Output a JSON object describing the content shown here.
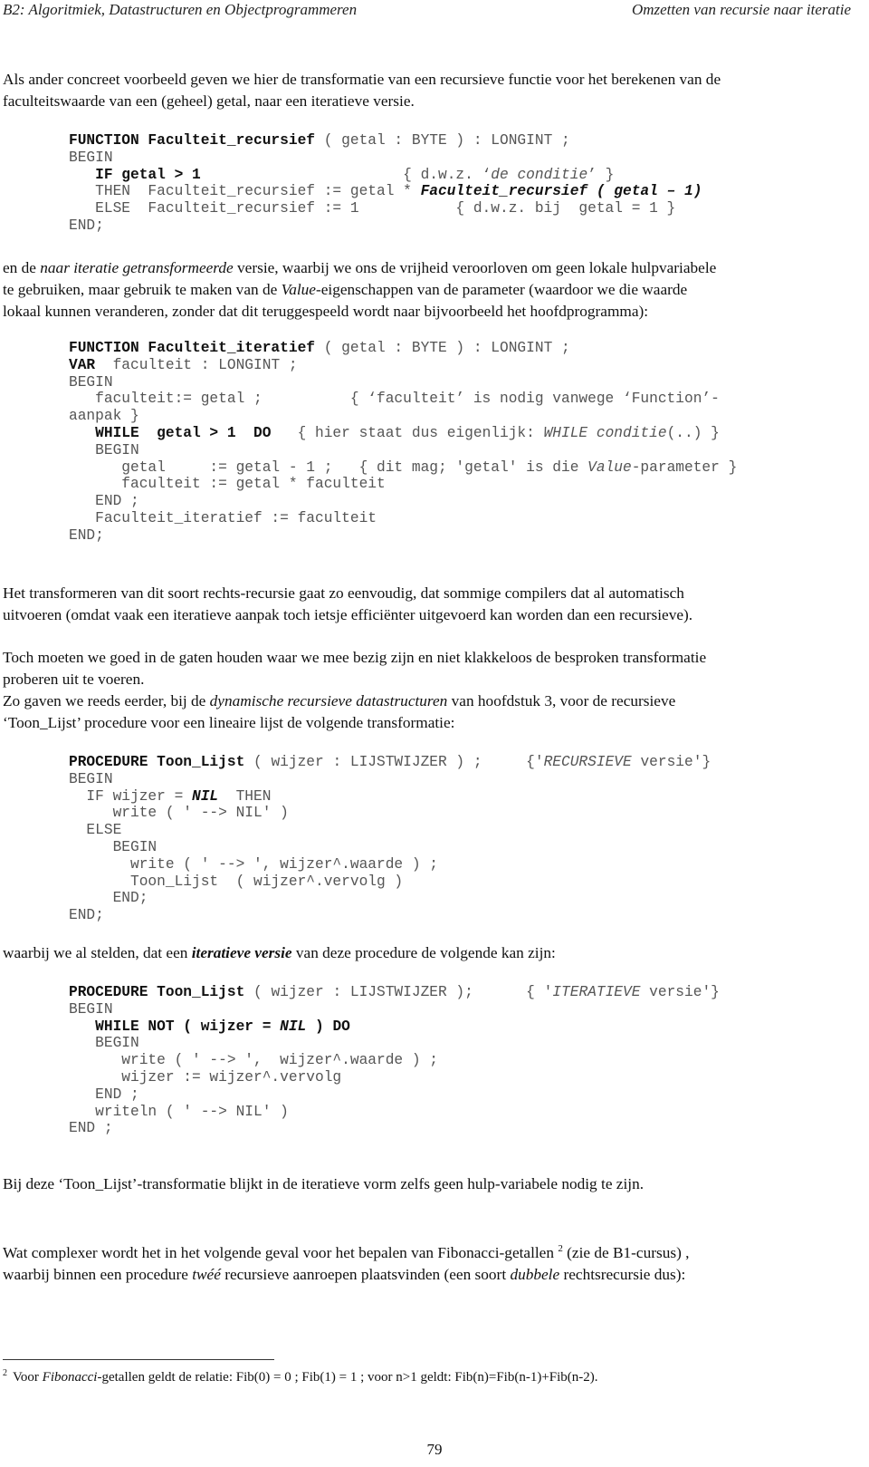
{
  "header": {
    "left": "B2: Algoritmiek, Datastructuren en Objectprogrammeren",
    "right": "Omzetten van recursie naar iteratie"
  },
  "intro": {
    "line1": "Als ander concreet voorbeeld geven we hier de transformatie van een recursieve functie voor het berekenen van de",
    "line2": "faculteitswaarde van een (geheel) getal, naar een iteratieve versie."
  },
  "code1": [
    {
      "parts": [
        {
          "t": "FUNCTION Faculteit_recursief",
          "s": "b"
        },
        {
          "t": " ( getal : BYTE ) : LONGINT ;",
          "s": ""
        }
      ]
    },
    {
      "parts": [
        {
          "t": "BEGIN",
          "s": ""
        }
      ]
    },
    {
      "parts": [
        {
          "t": "   IF getal > 1",
          "s": "b"
        },
        {
          "t": "                       { d.w.z. ‘",
          "s": ""
        },
        {
          "t": "de conditie",
          "s": "i"
        },
        {
          "t": "’ }",
          "s": ""
        }
      ]
    },
    {
      "parts": [
        {
          "t": "   THEN  Faculteit_recursief := getal * ",
          "s": ""
        },
        {
          "t": "Faculteit_recursief ( getal – 1)",
          "s": "bi"
        }
      ]
    },
    {
      "parts": [
        {
          "t": "   ELSE  Faculteit_recursief := 1           { d.w.z. bij  getal = 1 }",
          "s": ""
        }
      ]
    },
    {
      "parts": [
        {
          "t": "END;",
          "s": ""
        }
      ]
    }
  ],
  "para2": {
    "a": "en de ",
    "a_it": "naar iteratie getransformeerde",
    "b": " versie, waarbij we ons de vrijheid veroorloven om geen lokale hulpvariabele",
    "c": "te gebruiken, maar gebruik te maken van de ",
    "c_it": "Value",
    "d": "-eigenschappen van de parameter (waardoor we die waarde",
    "e": "lokaal kunnen veranderen, zonder dat dit teruggespeeld wordt naar bijvoorbeeld het hoofdprogramma):"
  },
  "code2": [
    {
      "parts": [
        {
          "t": "FUNCTION Faculteit_iteratief",
          "s": "b"
        },
        {
          "t": " ( getal : BYTE ) : LONGINT ;",
          "s": ""
        }
      ]
    },
    {
      "parts": [
        {
          "t": "VAR",
          "s": "b"
        },
        {
          "t": "  faculteit : LONGINT ;",
          "s": ""
        }
      ]
    },
    {
      "parts": [
        {
          "t": "BEGIN",
          "s": ""
        }
      ]
    },
    {
      "parts": [
        {
          "t": "   faculteit:= getal ;          { ‘faculteit’ is nodig vanwege ‘Function’-",
          "s": ""
        }
      ]
    },
    {
      "parts": [
        {
          "t": "aanpak }",
          "s": ""
        }
      ]
    },
    {
      "parts": [
        {
          "t": "   WHILE  getal > 1  DO",
          "s": "b"
        },
        {
          "t": "   { hier staat dus eigenlijk: ",
          "s": ""
        },
        {
          "t": "WHILE conditie",
          "s": "i"
        },
        {
          "t": "(..) }",
          "s": ""
        }
      ]
    },
    {
      "parts": [
        {
          "t": "   BEGIN",
          "s": ""
        }
      ]
    },
    {
      "parts": [
        {
          "t": "      getal     := getal - 1 ;   { dit mag; 'getal' is die ",
          "s": ""
        },
        {
          "t": "Value",
          "s": "i"
        },
        {
          "t": "-parameter }",
          "s": ""
        }
      ]
    },
    {
      "parts": [
        {
          "t": "      faculteit := getal * faculteit",
          "s": ""
        }
      ]
    },
    {
      "parts": [
        {
          "t": "   END ;",
          "s": ""
        }
      ]
    },
    {
      "parts": [
        {
          "t": "   Faculteit_iteratief := faculteit",
          "s": ""
        }
      ]
    },
    {
      "parts": [
        {
          "t": "END;",
          "s": ""
        }
      ]
    }
  ],
  "para3": {
    "line1": "Het transformeren van dit soort rechts-recursie gaat zo eenvoudig, dat sommige compilers dat al automatisch",
    "line2": "uitvoeren (omdat vaak een iteratieve aanpak toch ietsje efficiënter uitgevoerd kan worden dan een recursieve)."
  },
  "para4": {
    "line1": "Toch moeten we goed in de gaten houden waar we mee bezig zijn en niet klakkeloos de besproken transformatie",
    "line2": "proberen uit te voeren.",
    "line3a": "Zo gaven we reeds eerder, bij de ",
    "line3_it": "dynamische recursieve datastructuren",
    "line3b": " van hoofdstuk 3, voor de recursieve",
    "line4": "‘Toon_Lijst’ procedure voor een lineaire lijst de volgende transformatie:"
  },
  "code3": [
    {
      "parts": [
        {
          "t": "PROCEDURE Toon_Lijst",
          "s": "b"
        },
        {
          "t": " ( wijzer : LIJSTWIJZER ) ;     {'",
          "s": ""
        },
        {
          "t": "RECURSIEVE",
          "s": "i"
        },
        {
          "t": " versie'}",
          "s": ""
        }
      ]
    },
    {
      "parts": [
        {
          "t": "BEGIN",
          "s": ""
        }
      ]
    },
    {
      "parts": [
        {
          "t": "  IF wijzer = ",
          "s": ""
        },
        {
          "t": "NIL",
          "s": "bi"
        },
        {
          "t": "  THEN",
          "s": ""
        }
      ]
    },
    {
      "parts": [
        {
          "t": "     write ( ' --> NIL' )",
          "s": ""
        }
      ]
    },
    {
      "parts": [
        {
          "t": "  ELSE",
          "s": ""
        }
      ]
    },
    {
      "parts": [
        {
          "t": "     BEGIN",
          "s": ""
        }
      ]
    },
    {
      "parts": [
        {
          "t": "       write ( ' --> ', wijzer^.waarde ) ;",
          "s": ""
        }
      ]
    },
    {
      "parts": [
        {
          "t": "       Toon_Lijst  ( wijzer^.vervolg )",
          "s": ""
        }
      ]
    },
    {
      "parts": [
        {
          "t": "     END;",
          "s": ""
        }
      ]
    },
    {
      "parts": [
        {
          "t": "END;",
          "s": ""
        }
      ]
    }
  ],
  "para5": {
    "a": "waarbij we al stelden, dat een  ",
    "a_bi": "iteratieve versie",
    "b": " van deze procedure de volgende kan zijn:"
  },
  "code4": [
    {
      "parts": [
        {
          "t": "PROCEDURE Toon_Lijst",
          "s": "b"
        },
        {
          "t": " ( wijzer : LIJSTWIJZER );      { '",
          "s": ""
        },
        {
          "t": "ITERATIEVE",
          "s": "i"
        },
        {
          "t": " versie'}",
          "s": ""
        }
      ]
    },
    {
      "parts": [
        {
          "t": "BEGIN",
          "s": ""
        }
      ]
    },
    {
      "parts": [
        {
          "t": "   WHILE NOT ( wijzer = ",
          "s": "b"
        },
        {
          "t": "NIL",
          "s": "bi"
        },
        {
          "t": " ) DO",
          "s": "b"
        }
      ]
    },
    {
      "parts": [
        {
          "t": "   BEGIN",
          "s": ""
        }
      ]
    },
    {
      "parts": [
        {
          "t": "      write ( ' --> ',  wijzer^.waarde ) ;",
          "s": ""
        }
      ]
    },
    {
      "parts": [
        {
          "t": "      wijzer := wijzer^.vervolg",
          "s": ""
        }
      ]
    },
    {
      "parts": [
        {
          "t": "   END ;",
          "s": ""
        }
      ]
    },
    {
      "parts": [
        {
          "t": "   writeln ( ' --> NIL' )",
          "s": ""
        }
      ]
    },
    {
      "parts": [
        {
          "t": "END ;",
          "s": ""
        }
      ]
    }
  ],
  "para6": "Bij deze ‘Toon_Lijst’-transformatie blijkt in de iteratieve vorm zelfs geen hulp-variabele nodig te zijn.",
  "para7": {
    "line1a": "Wat complexer wordt het in het volgende geval voor het bepalen van Fibonacci-getallen ",
    "ref": "2",
    "line1b": " (zie de B1-cursus) ,",
    "line2a": "waarbij binnen een procedure ",
    "line2_it1": "twéé",
    "line2b": " recursieve aanroepen plaatsvinden (een soort ",
    "line2_it2": "dubbele",
    "line2c": " rechtsrecursie dus):"
  },
  "footnote": {
    "num": "2",
    "a": "Voor ",
    "a_it": "Fibonacci",
    "b": "-getallen geldt de relatie: Fib(0) = 0 ; Fib(1) = 1 ; voor n>1 geldt: Fib(n)=Fib(n-1)+Fib(n-2)."
  },
  "page_number": "79"
}
